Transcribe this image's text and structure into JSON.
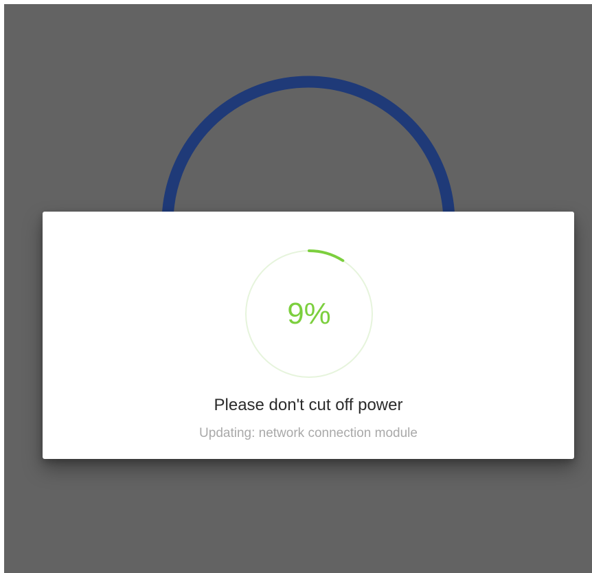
{
  "background": {
    "color": "#636363",
    "ring_color": "#1f3a78"
  },
  "dialog": {
    "progress": {
      "percent_label": "9%",
      "value": 0.09,
      "track_color": "#e6f4dc",
      "fill_color": "#7ccf3e"
    },
    "title": "Please don't cut off power",
    "subtitle": "Updating: network connection module"
  }
}
